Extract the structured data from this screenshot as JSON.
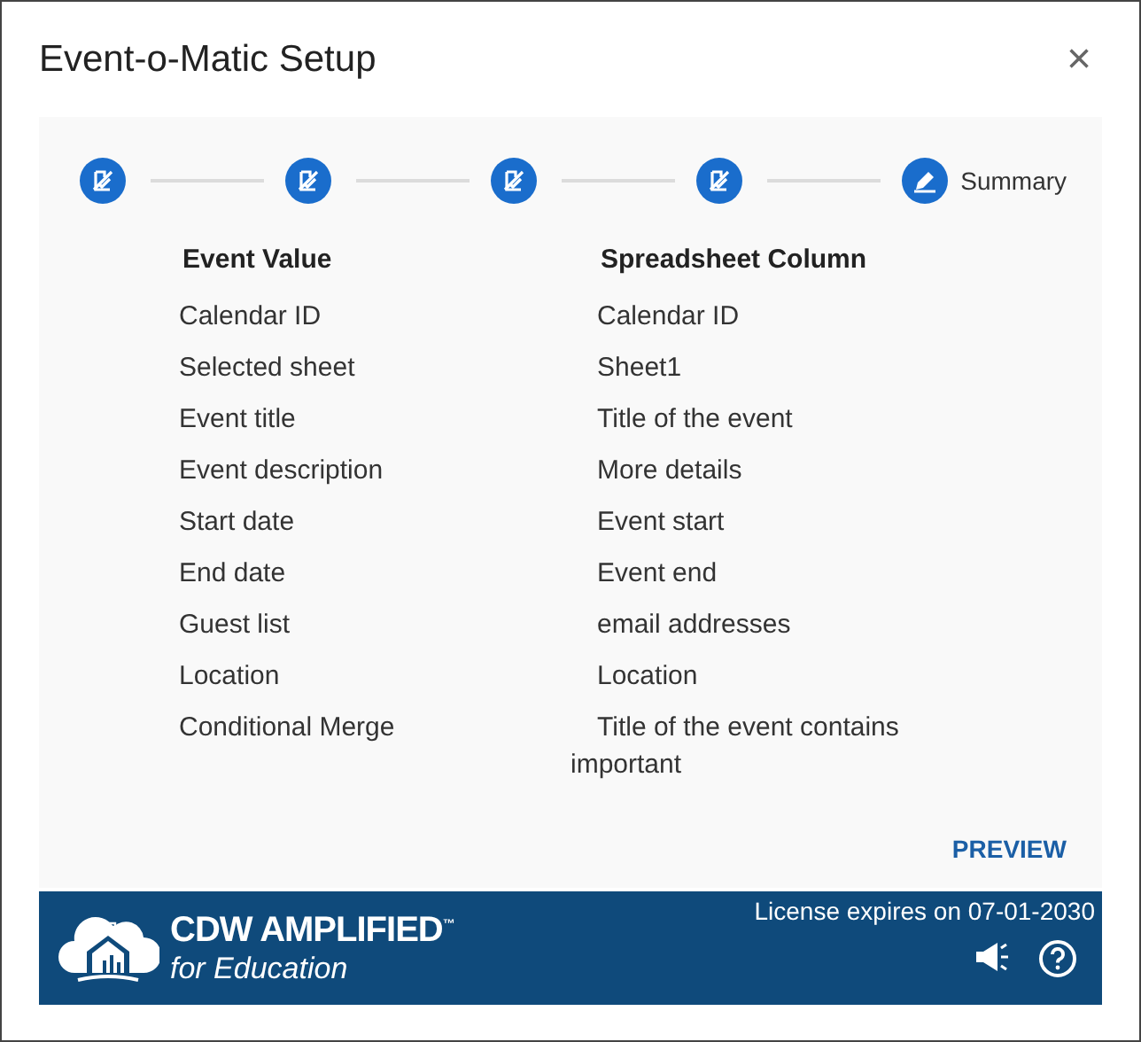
{
  "dialog": {
    "title": "Event-o-Matic Setup",
    "close": "×"
  },
  "steps": [
    {
      "kind": "done"
    },
    {
      "kind": "done"
    },
    {
      "kind": "done"
    },
    {
      "kind": "done"
    },
    {
      "kind": "current",
      "label": "Summary"
    }
  ],
  "table": {
    "columns": [
      "Event Value",
      "Spreadsheet Column"
    ],
    "rows": [
      [
        "Calendar ID",
        "Calendar ID"
      ],
      [
        "Selected sheet",
        "Sheet1"
      ],
      [
        "Event title",
        "Title of the event"
      ],
      [
        "Event description",
        "More details"
      ],
      [
        "Start date",
        "Event start"
      ],
      [
        "End date",
        "Event end"
      ],
      [
        "Guest list",
        "email addresses"
      ],
      [
        "Location",
        "Location"
      ],
      [
        "Conditional Merge",
        "Title of the event contains important"
      ]
    ]
  },
  "preview_button": "PREVIEW",
  "footer": {
    "brand": "CDW AMPLIFIED",
    "trademark": "™",
    "tagline": "for Education",
    "license": "License expires on 07-01-2030"
  }
}
